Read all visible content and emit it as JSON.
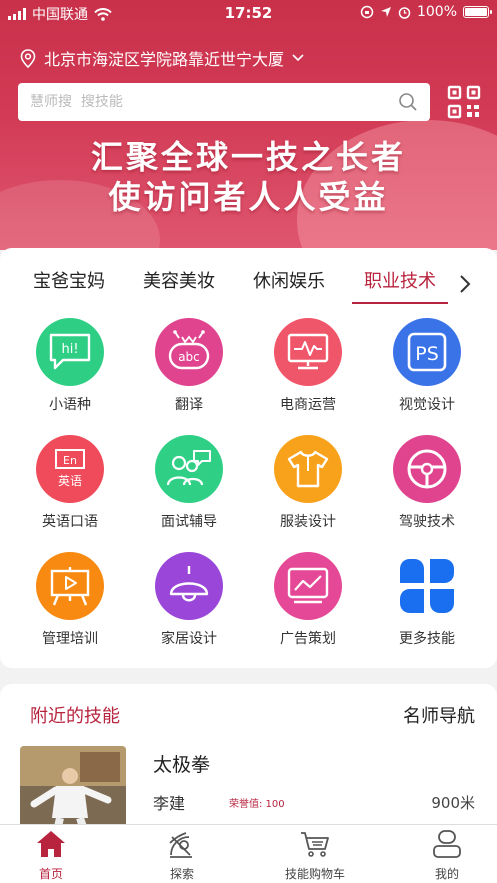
{
  "status_bar": {
    "carrier": "中国联通",
    "time": "17:52",
    "battery": "100%"
  },
  "header": {
    "location": "北京市海淀区学院路靠近世宁大厦",
    "search_placeholder": "慧师搜  搜技能",
    "slogan_line1": "汇聚全球一技之长者",
    "slogan_line2": "使访问者人人受益"
  },
  "categories": {
    "tabs": [
      {
        "label": "宝爸宝妈",
        "active": false
      },
      {
        "label": "美容美妆",
        "active": false
      },
      {
        "label": "休闲娱乐",
        "active": false
      },
      {
        "label": "职业技术",
        "active": true
      }
    ],
    "items": [
      {
        "label": "小语种",
        "icon": "speech-bubble-icon",
        "color": "#2ecf85"
      },
      {
        "label": "翻译",
        "icon": "robot-abc-icon",
        "color": "#e0448f"
      },
      {
        "label": "电商运营",
        "icon": "monitor-icon",
        "color": "#f0566a"
      },
      {
        "label": "视觉设计",
        "icon": "ps-icon",
        "color": "#3a73e8"
      },
      {
        "label": "英语口语",
        "icon": "english-icon",
        "color": "#f04b5a"
      },
      {
        "label": "面试辅导",
        "icon": "people-chat-icon",
        "color": "#2fcf86"
      },
      {
        "label": "服装设计",
        "icon": "shirt-icon",
        "color": "#f8a21c"
      },
      {
        "label": "驾驶技术",
        "icon": "steering-wheel-icon",
        "color": "#e0448f"
      },
      {
        "label": "管理培训",
        "icon": "presentation-icon",
        "color": "#f88a12"
      },
      {
        "label": "家居设计",
        "icon": "lamp-icon",
        "color": "#9a46d8"
      },
      {
        "label": "广告策划",
        "icon": "chart-screen-icon",
        "color": "#e44896"
      },
      {
        "label": "更多技能",
        "icon": "four-petals-icon",
        "color": "#1a6ff0"
      }
    ],
    "text": {
      "ps": "PS",
      "abc": "abc",
      "hi": "hi!",
      "en": "En",
      "en_cn": "英语"
    }
  },
  "nearby": {
    "title": "附近的技能",
    "right_link": "名师导航",
    "item": {
      "skill": "太极拳",
      "teacher": "李建",
      "honor": "荣誉值: 100",
      "distance": "900米"
    }
  },
  "tabbar": {
    "items": [
      {
        "label": "首页",
        "icon": "home-icon",
        "active": true
      },
      {
        "label": "探索",
        "icon": "explore-icon",
        "active": false
      },
      {
        "label": "技能购物车",
        "icon": "cart-icon",
        "active": false
      },
      {
        "label": "我的",
        "icon": "user-icon",
        "active": false
      }
    ]
  },
  "colors": {
    "brand": "#b8243e",
    "header": "#d23a55"
  }
}
